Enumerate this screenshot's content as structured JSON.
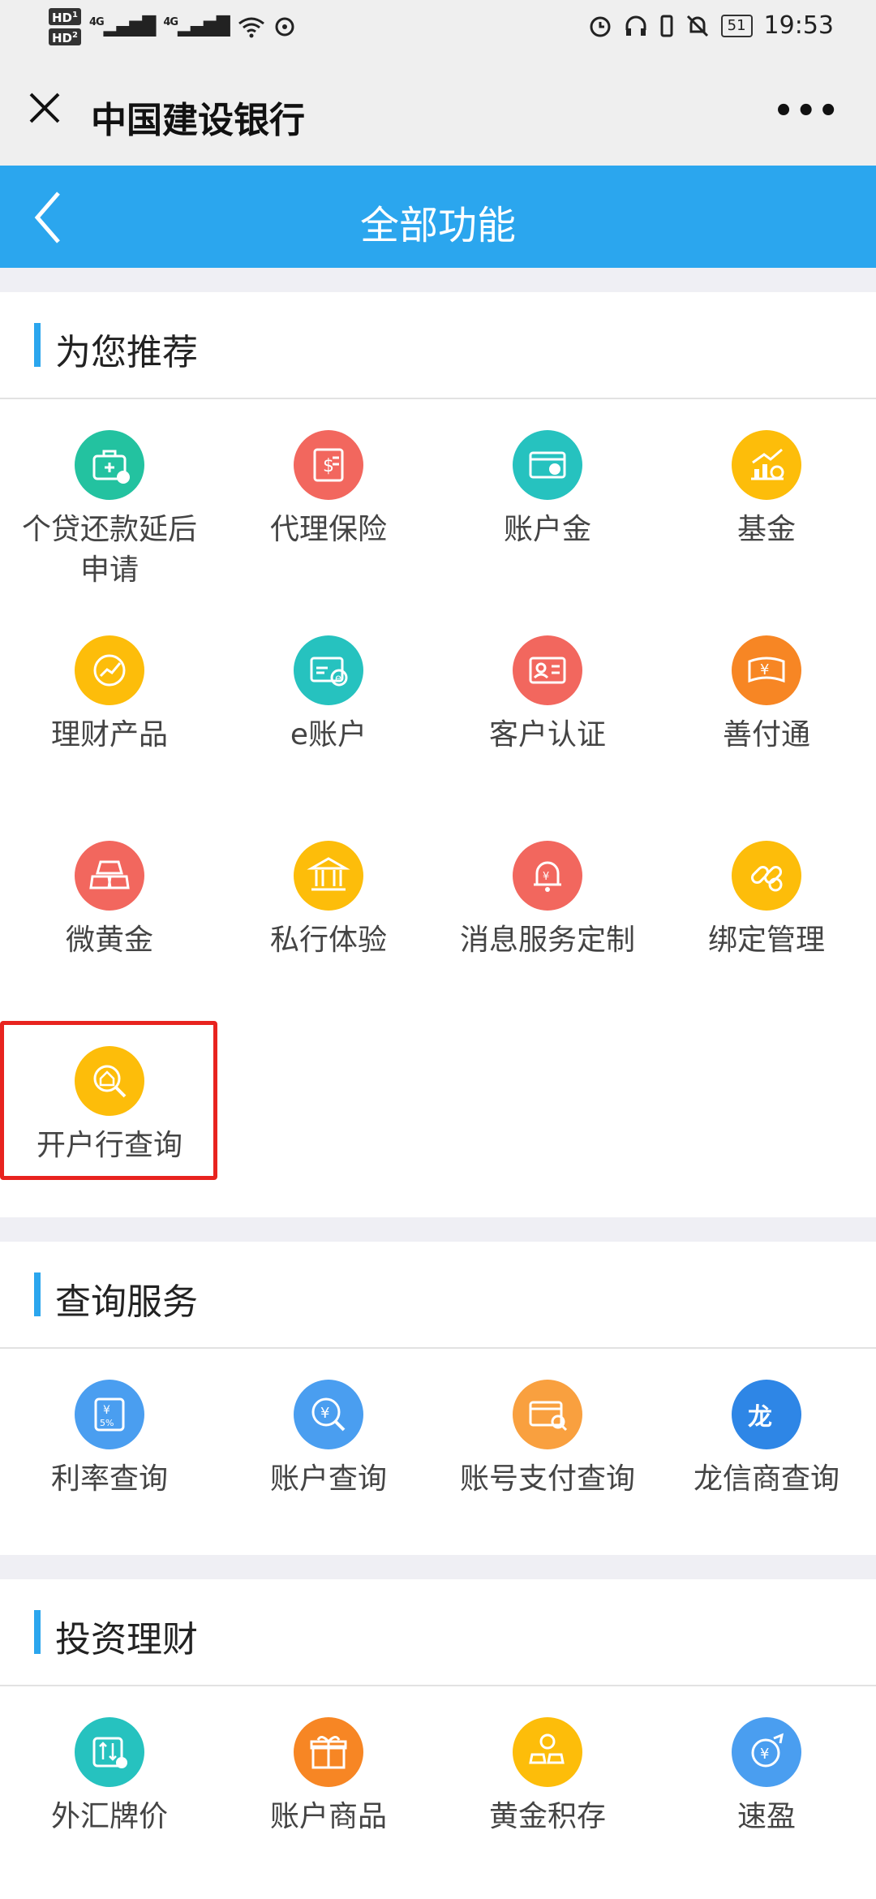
{
  "status_bar": {
    "hd1": "HD",
    "hd1_sub": "1",
    "hd2": "HD",
    "hd2_sub": "2",
    "network1": "4G",
    "network2": "4G",
    "battery": "51",
    "time": "19:53"
  },
  "title_bar": {
    "title": "中国建设银行",
    "more": "•••"
  },
  "nav": {
    "title": "全部功能"
  },
  "sections": [
    {
      "title": "为您推荐",
      "items": [
        {
          "label": "个贷还款延后申请",
          "color": "#23c2a0",
          "icon": "loan-briefcase-icon"
        },
        {
          "label": "代理保险",
          "color": "#f2675e",
          "icon": "insurance-document-icon"
        },
        {
          "label": "账户金",
          "color": "#26c2bf",
          "icon": "account-gold-card-icon"
        },
        {
          "label": "基金",
          "color": "#fdbd0a",
          "icon": "fund-chart-icon"
        },
        {
          "label": "理财产品",
          "color": "#fdbd0a",
          "icon": "wealth-trend-icon"
        },
        {
          "label": "e账户",
          "color": "#26c2bf",
          "icon": "e-account-card-icon"
        },
        {
          "label": "客户认证",
          "color": "#f2675e",
          "icon": "customer-id-card-icon"
        },
        {
          "label": "善付通",
          "color": "#f78624",
          "icon": "payment-banknote-icon"
        },
        {
          "label": "微黄金",
          "color": "#f2675e",
          "icon": "gold-bars-icon"
        },
        {
          "label": "私行体验",
          "color": "#fdbd0a",
          "icon": "private-bank-building-icon"
        },
        {
          "label": "消息服务定制",
          "color": "#f2675e",
          "icon": "notification-bell-icon"
        },
        {
          "label": "绑定管理",
          "color": "#fdbd0a",
          "icon": "binding-link-icon"
        },
        {
          "label": "开户行查询",
          "color": "#fdbd0a",
          "icon": "bank-search-icon"
        }
      ]
    },
    {
      "title": "查询服务",
      "items": [
        {
          "label": "利率查询",
          "color": "#4a9ef0",
          "icon": "interest-rate-icon",
          "badge": "5%"
        },
        {
          "label": "账户查询",
          "color": "#4a9ef0",
          "icon": "account-search-icon"
        },
        {
          "label": "账号支付查询",
          "color": "#f9a03f",
          "icon": "payment-search-icon"
        },
        {
          "label": "龙信商查询",
          "color": "#2e86e6",
          "icon": "longxin-merchant-icon"
        }
      ]
    },
    {
      "title": "投资理财",
      "items": [
        {
          "label": "外汇牌价",
          "color": "#26c2bf",
          "icon": "forex-rate-icon"
        },
        {
          "label": "账户商品",
          "color": "#f78624",
          "icon": "gift-box-icon"
        },
        {
          "label": "黄金积存",
          "color": "#fdbd0a",
          "icon": "gold-saving-icon"
        },
        {
          "label": "速盈",
          "color": "#4a9ef0",
          "icon": "quick-earn-icon"
        }
      ]
    }
  ]
}
